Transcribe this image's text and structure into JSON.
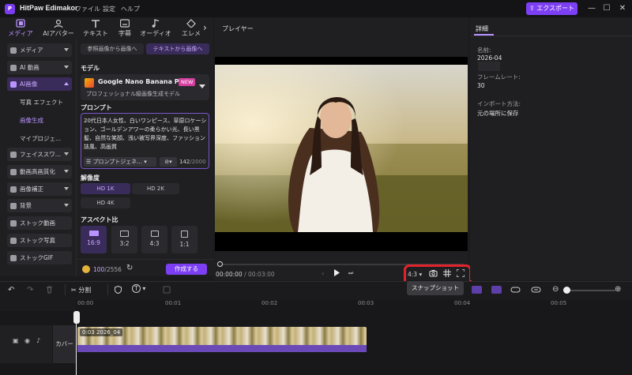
{
  "titlebar": {
    "app_name": "HitPaw Edimakor",
    "menus": [
      "ファイル",
      "設定",
      "ヘルプ"
    ],
    "export_label": "エクスポート",
    "logo_text": "P"
  },
  "tabs": [
    {
      "label": "メディア",
      "icon": "media-icon"
    },
    {
      "label": "AIアバター",
      "icon": "avatar-icon"
    },
    {
      "label": "テキスト",
      "icon": "text-icon"
    },
    {
      "label": "字幕",
      "icon": "subtitle-icon"
    },
    {
      "label": "オーディオ",
      "icon": "audio-icon"
    },
    {
      "label": "エレメ",
      "icon": "element-icon"
    }
  ],
  "sidebar": {
    "items": [
      {
        "label": "メディア"
      },
      {
        "label": "AI 動画"
      },
      {
        "label": "AI画像"
      },
      {
        "label": "フェイススワ..."
      },
      {
        "label": "動画高画質化"
      },
      {
        "label": "画像補正"
      },
      {
        "label": "背景"
      },
      {
        "label": "ストック動画"
      },
      {
        "label": "ストック写真"
      },
      {
        "label": "ストックGIF"
      }
    ],
    "subitems": [
      {
        "label": "写真 エフェクト"
      },
      {
        "label": "画像生成"
      },
      {
        "label": "マイプロジェ..."
      }
    ]
  },
  "panel": {
    "mode_ref": "参照画像から画像へ",
    "mode_text": "テキストから画像へ",
    "model_label": "モデル",
    "model_name": "Google Nano Banana Pro",
    "model_badge": "NEW",
    "model_desc": "プロフェッショナル級画像生成モデル",
    "prompt_label": "プロンプト",
    "prompt_text": "20代日本人女性、白いワンピース、草原ロケーション、ゴールデンアワーの柔らかい光、長い黒髪、自然な笑顔、浅い被写界深度、ファッション誌風、高画質",
    "prompt_generator": "プロンプトジェネ...",
    "char_count": "142",
    "char_max": "/2000",
    "res_label": "解像度",
    "res": [
      "HD 1K",
      "HD 2K",
      "HD 4K"
    ],
    "aspect_label": "アスペクト比",
    "aspects": [
      "16:9",
      "3:2",
      "4:3",
      "1:1"
    ],
    "credits": "100",
    "credits_total": "/2556",
    "create_label": "作成する"
  },
  "player": {
    "title": "プレイヤー",
    "time_current": "00:00:00",
    "time_sep": " / ",
    "time_total": "00:03:00",
    "ratio": "4:3",
    "tooltip": "スナップショット"
  },
  "details": {
    "tab": "詳細",
    "name_label": "名前:",
    "name_value": "2026-04",
    "framerate_label": "フレームレート:",
    "framerate_value": "30",
    "import_label": "インポート方法:",
    "import_value": "元の場所に保存"
  },
  "timeline": {
    "split_label": "分割",
    "ruler": [
      "00:00",
      "00:01",
      "00:02",
      "00:03",
      "00:04",
      "00:05"
    ],
    "cover_label": "カバー",
    "clip_label": "0:03  2026_04"
  },
  "colors": {
    "accent": "#7d3ff3",
    "highlight": "#e0242b"
  }
}
